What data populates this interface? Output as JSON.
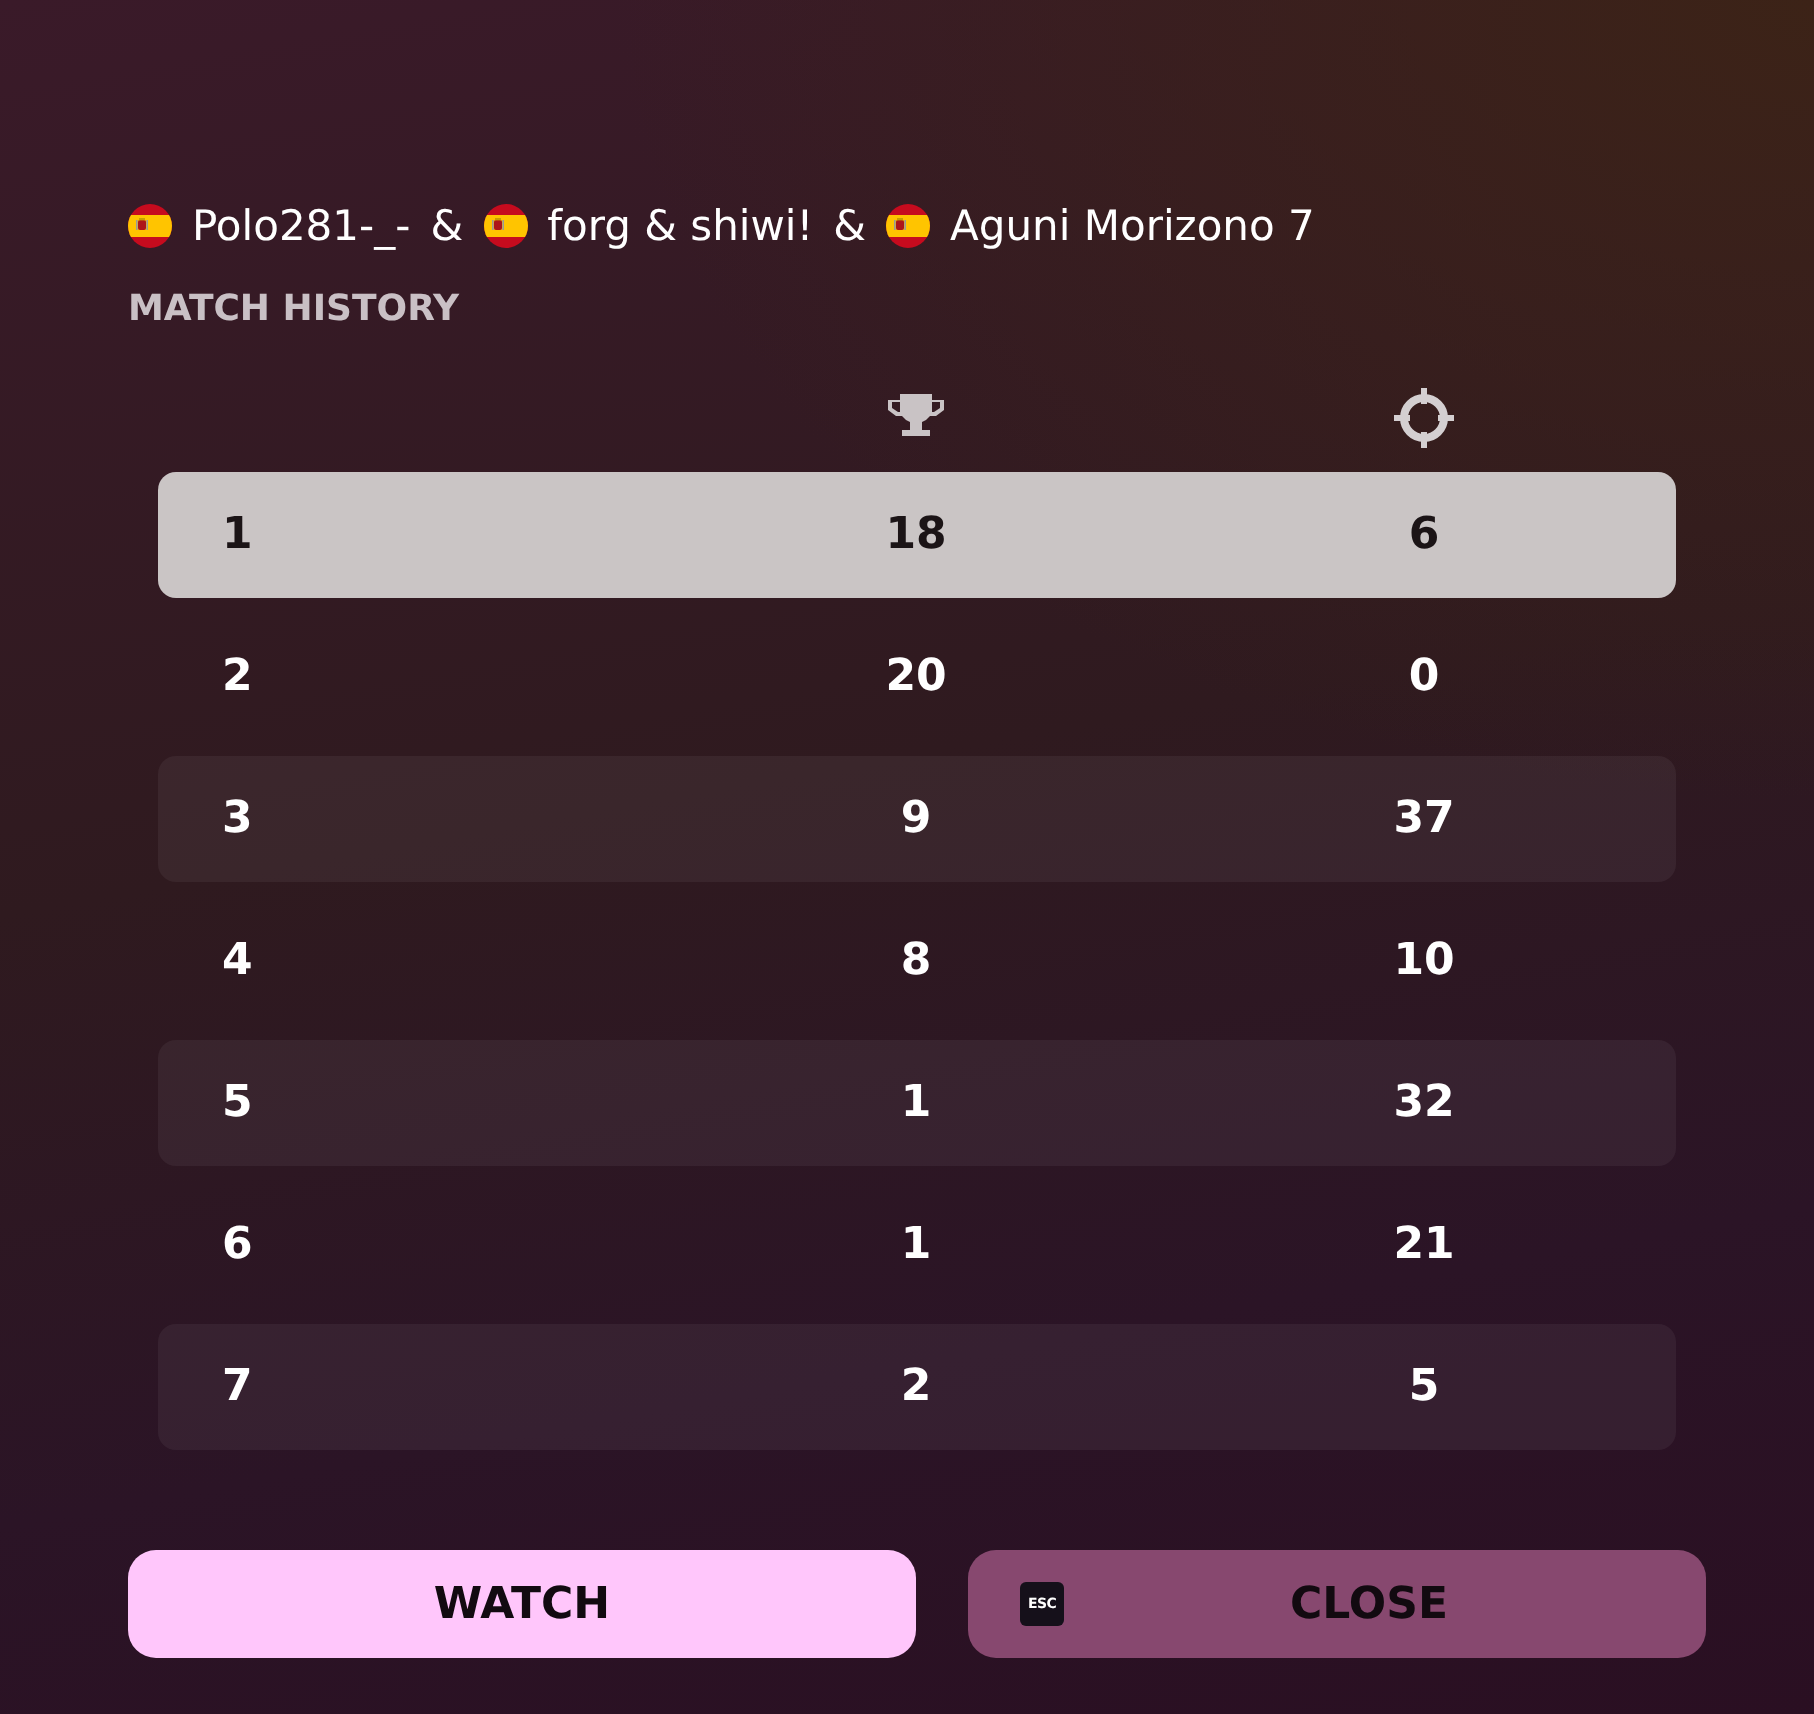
{
  "team": {
    "players": [
      {
        "name": "Polo281-_-",
        "separator": "&"
      },
      {
        "name": "forg & shiwi!",
        "separator": "&"
      },
      {
        "name": "Aguni Morizono 7"
      }
    ]
  },
  "section_title": "MATCH HISTORY",
  "table": {
    "rows": [
      {
        "cells": [
          "1",
          "18",
          "6"
        ],
        "selected": true
      },
      {
        "cells": [
          "2",
          "20",
          "0"
        ],
        "selected": false
      },
      {
        "cells": [
          "3",
          "9",
          "37"
        ],
        "selected": false
      },
      {
        "cells": [
          "4",
          "8",
          "10"
        ],
        "selected": false
      },
      {
        "cells": [
          "5",
          "1",
          "32"
        ],
        "selected": false
      },
      {
        "cells": [
          "6",
          "1",
          "21"
        ],
        "selected": false
      },
      {
        "cells": [
          "7",
          "2",
          "5"
        ],
        "selected": false
      }
    ]
  },
  "buttons": [
    {
      "kind": "primary",
      "label": "WATCH"
    },
    {
      "kind": "secondary",
      "label": "CLOSE",
      "key_hint": "ESC"
    }
  ]
}
